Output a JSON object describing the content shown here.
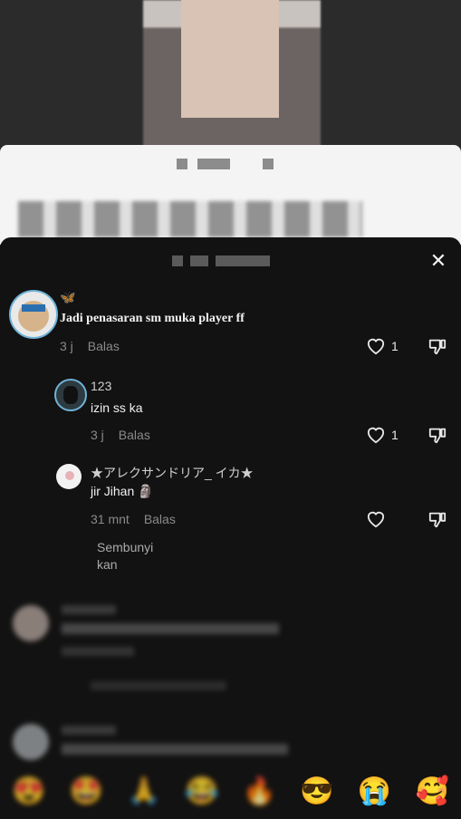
{
  "comments": [
    {
      "username": "🦋",
      "text": "Jadi penasaran sm muka player ff",
      "time": "3 j",
      "reply_label": "Balas",
      "likes": "1"
    }
  ],
  "replies": [
    {
      "username": "123",
      "text": "izin ss ka",
      "time": "3 j",
      "reply_label": "Balas",
      "likes": "1"
    },
    {
      "username": "★アレクサンドリア_ イカ★",
      "text": "jir Jihan 🗿",
      "time": "31 mnt",
      "reply_label": "Balas",
      "likes": ""
    }
  ],
  "more_replies_label": "Sembunyikan",
  "emojis": [
    "😍",
    "🤩",
    "🙏",
    "😂",
    "🔥",
    "😎",
    "😭",
    "🥰"
  ],
  "icons": {
    "close": "close-icon",
    "like": "heart-icon",
    "dislike": "thumbs-down-icon"
  }
}
